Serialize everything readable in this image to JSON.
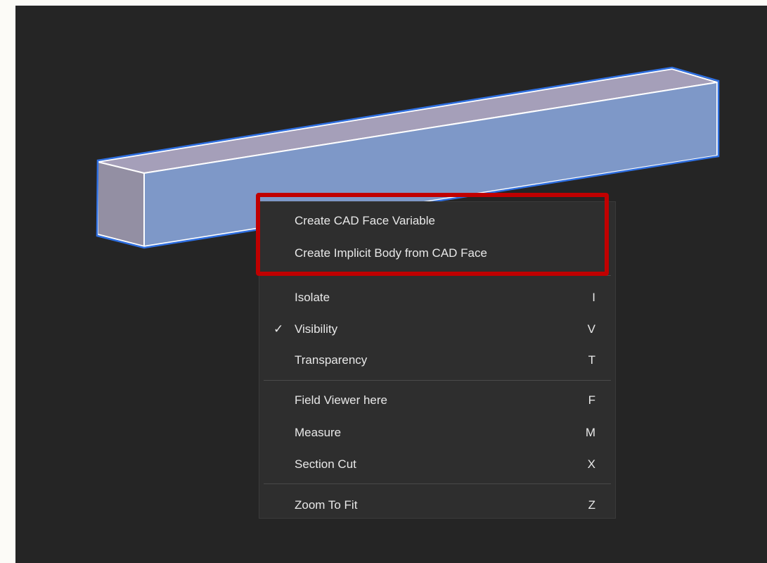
{
  "colors": {
    "viewport_bg": "#252525",
    "menu_bg": "#2e2e2e",
    "menu_text": "#e8e8e8",
    "highlight": "#c00000",
    "beam_front": "#7e98c8",
    "beam_end": "#938fa3",
    "beam_top": "#a59fb9",
    "selection_outline": "#2f6fe0"
  },
  "viewport": {
    "model": "rectangular-beam"
  },
  "context_menu": {
    "items": [
      {
        "label": "Create CAD Face Variable",
        "shortcut": "",
        "checked": false
      },
      {
        "label": "Create Implicit Body from CAD Face",
        "shortcut": "",
        "checked": false
      },
      {
        "label": "Isolate",
        "shortcut": "I",
        "checked": false
      },
      {
        "label": "Visibility",
        "shortcut": "V",
        "checked": true,
        "check_mark": "✓"
      },
      {
        "label": "Transparency",
        "shortcut": "T",
        "checked": false
      },
      {
        "label": "Field Viewer here",
        "shortcut": "F",
        "checked": false
      },
      {
        "label": "Measure",
        "shortcut": "M",
        "checked": false
      },
      {
        "label": "Section Cut",
        "shortcut": "X",
        "checked": false
      },
      {
        "label": "Zoom To Fit",
        "shortcut": "Z",
        "checked": false
      }
    ]
  }
}
